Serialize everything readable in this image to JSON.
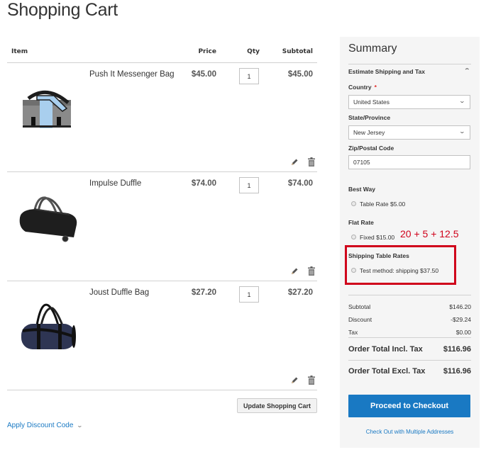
{
  "page": {
    "title": "Shopping Cart"
  },
  "cart": {
    "columns": {
      "item": "Item",
      "price": "Price",
      "qty": "Qty",
      "subtotal": "Subtotal"
    },
    "items": [
      {
        "name": "Push It Messenger Bag",
        "price": "$45.00",
        "qty": "1",
        "subtotal": "$45.00",
        "image": "messenger-bag-gray-blue"
      },
      {
        "name": "Impulse Duffle",
        "price": "$74.00",
        "qty": "1",
        "subtotal": "$74.00",
        "image": "duffle-black-wheeled"
      },
      {
        "name": "Joust Duffle Bag",
        "price": "$27.20",
        "qty": "1",
        "subtotal": "$27.20",
        "image": "duffle-navy"
      }
    ],
    "actions": {
      "edit_icon": "pencil-icon",
      "delete_icon": "trash-icon"
    },
    "update_button": "Update Shopping Cart",
    "discount_link": "Apply Discount Code"
  },
  "summary": {
    "title": "Summary",
    "estimate": {
      "heading": "Estimate Shipping and Tax",
      "country_label": "Country",
      "required_mark": "*",
      "country_value": "United States",
      "state_label": "State/Province",
      "state_value": "New Jersey",
      "zip_label": "Zip/Postal Code",
      "zip_value": "07105"
    },
    "carriers": [
      {
        "title": "Best Way",
        "rate": "Table Rate $5.00"
      },
      {
        "title": "Flat Rate",
        "rate": "Fixed $15.00"
      },
      {
        "title": "Shipping Table Rates",
        "rate": "Test method: shipping $37.50"
      }
    ],
    "annotation": "20 + 5 + 12.5",
    "annotation_color": "#d0021b",
    "totals": [
      {
        "label": "Subtotal",
        "value": "$146.20"
      },
      {
        "label": "Discount",
        "value": "-$29.24"
      },
      {
        "label": "Tax",
        "value": "$0.00"
      }
    ],
    "order_total_incl": {
      "label": "Order Total Incl. Tax",
      "value": "$116.96"
    },
    "order_total_excl": {
      "label": "Order Total Excl. Tax",
      "value": "$116.96"
    },
    "checkout_button": "Proceed to Checkout",
    "multi_address_link": "Check Out with Multiple Addresses"
  },
  "colors": {
    "accent": "#1979c3",
    "panel_bg": "#f5f5f5",
    "required": "#e02b27"
  }
}
